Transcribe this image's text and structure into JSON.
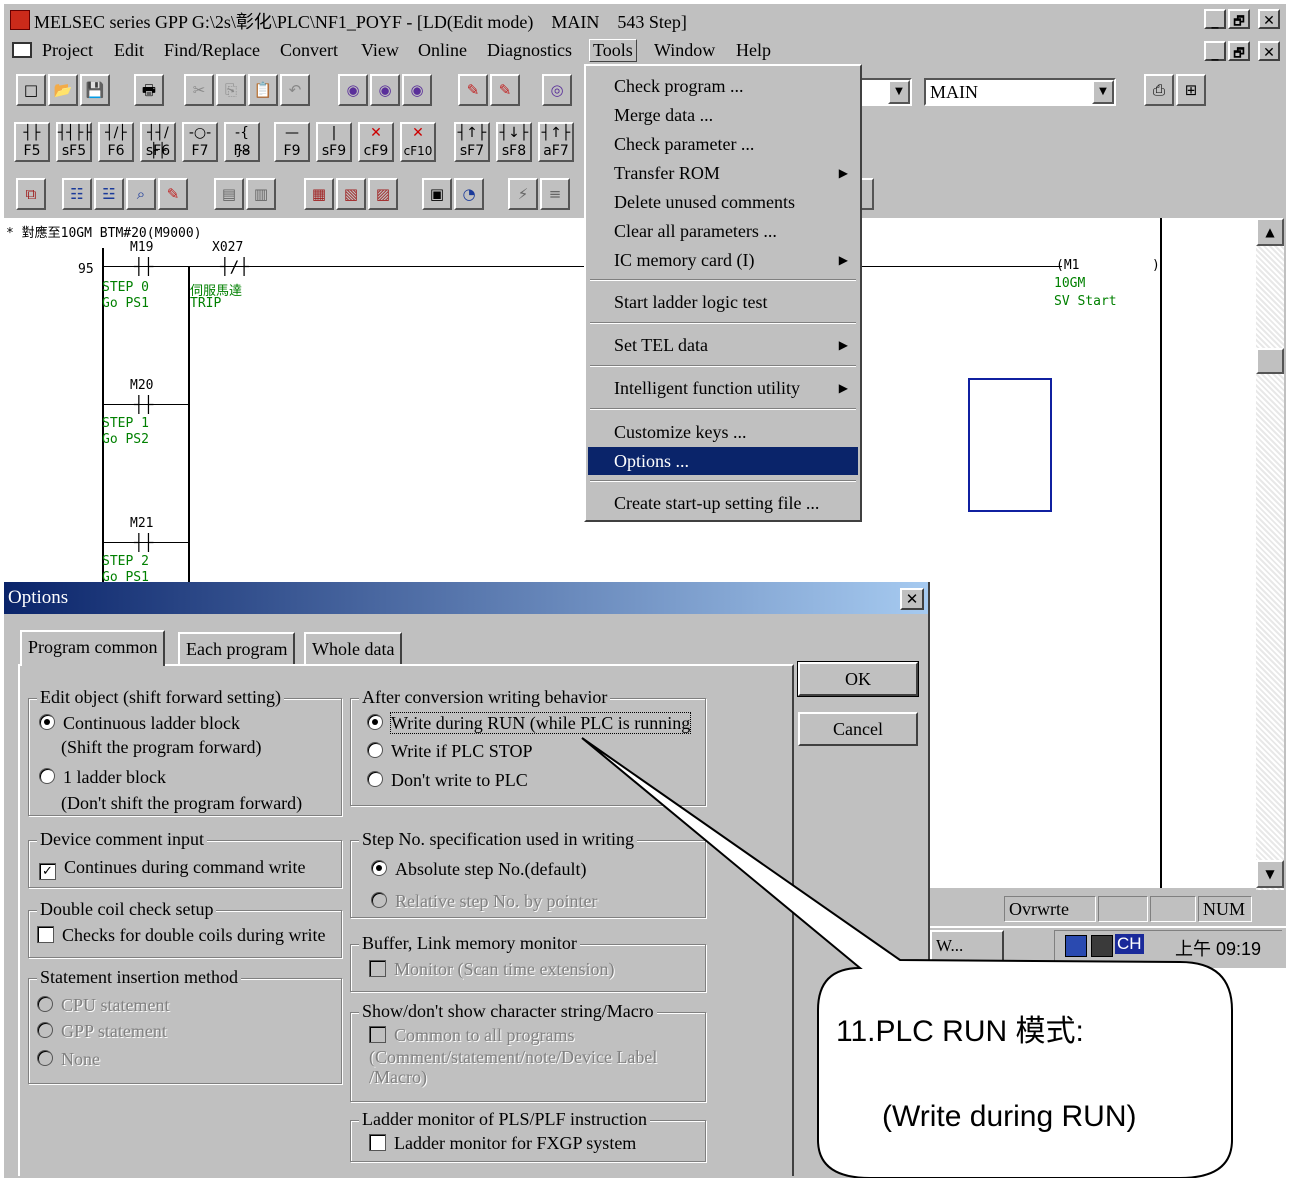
{
  "window": {
    "title": "MELSEC series GPP G:\\2s\\彰化\\PLC\\NF1_POYF - [LD(Edit mode)    MAIN    543 Step]",
    "min": "_",
    "max": "🗗",
    "close": "✕"
  },
  "menubar": {
    "items": [
      "Project",
      "Edit",
      "Find/Replace",
      "Convert",
      "View",
      "Online",
      "Diagnostics",
      "Tools",
      "Window",
      "Help"
    ]
  },
  "toolbar": {
    "program_combo": "MAIN",
    "fkeys": [
      {
        "sym": "┤├",
        "label": "F5"
      },
      {
        "sym": "┤┤├├",
        "label": "sF5"
      },
      {
        "sym": "┤/├",
        "label": "F6"
      },
      {
        "sym": "┤┤/├├",
        "label": "sF6"
      },
      {
        "sym": "-○-",
        "label": "F7"
      },
      {
        "sym": "-{ }-",
        "label": "F8"
      },
      {
        "sym": "—",
        "label": "F9"
      },
      {
        "sym": "|",
        "label": "sF9"
      },
      {
        "sym": "✕",
        "label": "cF9"
      },
      {
        "sym": "✕",
        "label": "cF10"
      },
      {
        "sym": "┤↑├",
        "label": "sF7"
      },
      {
        "sym": "┤↓├",
        "label": "sF8"
      },
      {
        "sym": "┤↑├",
        "label": "aF7"
      }
    ]
  },
  "ladder": {
    "comment": "* 對應至10GM BTM#20(M9000)",
    "step_no": "95",
    "contacts": [
      {
        "dev": "M19",
        "c1": "STEP 0",
        "c2": "Go PS1"
      },
      {
        "dev": "X027",
        "c1": "伺服馬達",
        "c2": "TRIP"
      },
      {
        "dev": "M20",
        "c1": "STEP 1",
        "c2": "Go PS2"
      },
      {
        "dev": "M21",
        "c1": "STEP 2",
        "c2": "Go PS1"
      }
    ],
    "coil": {
      "dev": "(M1",
      "c1": "10GM",
      "c2": "SV Start",
      "close": ")"
    }
  },
  "tools_menu": {
    "items": [
      {
        "label": "Check program ...",
        "sub": false
      },
      {
        "label": "Merge data ...",
        "sub": false
      },
      {
        "label": "Check parameter ...",
        "sub": false
      },
      {
        "label": "Transfer ROM",
        "sub": true
      },
      {
        "label": "Delete unused comments",
        "sub": false
      },
      {
        "label": "Clear all parameters ...",
        "sub": false
      },
      {
        "label": "IC memory card (I)",
        "sub": true
      },
      {
        "label": "Start ladder logic test",
        "sub": false
      },
      {
        "label": "Set TEL data",
        "sub": true
      },
      {
        "label": "Intelligent function utility",
        "sub": true
      },
      {
        "label": "Customize keys ...",
        "sub": false
      },
      {
        "label": "Options ...",
        "sub": false
      },
      {
        "label": "Create start-up setting file ...",
        "sub": false
      }
    ],
    "selected": "Options ...",
    "submenu_arrow": "▶"
  },
  "statusbar": {
    "mode": "Ovrwrte",
    "num": "NUM"
  },
  "taskbar": {
    "task": "W...",
    "ime": "CH",
    "clock": "上午 09:19"
  },
  "dialog": {
    "title": "Options",
    "close": "✕",
    "tabs": [
      "Program common",
      "Each program",
      "Whole data"
    ],
    "edit_object": {
      "title": "Edit object (shift forward setting)",
      "opt1": "Continuous ladder block",
      "opt1_sub": "(Shift the program forward)",
      "opt2": "1 ladder block",
      "opt2_sub": "(Don't shift the program forward)"
    },
    "device_comment": {
      "title": "Device comment input",
      "opt": "Continues during command write",
      "checked": true
    },
    "double_coil": {
      "title": "Double coil check setup",
      "opt": "Checks for double coils during write",
      "checked": false
    },
    "statement": {
      "title": "Statement insertion method",
      "opts": [
        "CPU statement",
        "GPP statement",
        "None"
      ]
    },
    "after_conversion": {
      "title": "After conversion writing behavior",
      "opts": [
        "Write during RUN (while PLC is running",
        "Write if PLC STOP",
        "Don't write to PLC"
      ],
      "selected": 0
    },
    "step_no": {
      "title": "Step No. specification used in writing",
      "opt1": "Absolute step No.(default)",
      "opt2": "Relative step No. by pointer"
    },
    "buffer": {
      "title": "Buffer, Link memory monitor",
      "opt": "Monitor (Scan time extension)"
    },
    "showmacro": {
      "title": "Show/don't show character string/Macro",
      "opt": "Common to all programs",
      "sub1": "(Comment/statement/note/Device Label",
      "sub2": "/Macro)"
    },
    "ladder_monitor": {
      "title": "Ladder monitor of PLS/PLF instruction",
      "opt": "Ladder monitor for FXGP system"
    },
    "ok": "OK",
    "cancel": "Cancel",
    "check_mark": "✓"
  },
  "callout": {
    "line1": "11.PLC RUN  模式:",
    "line2": "(Write during RUN)"
  }
}
